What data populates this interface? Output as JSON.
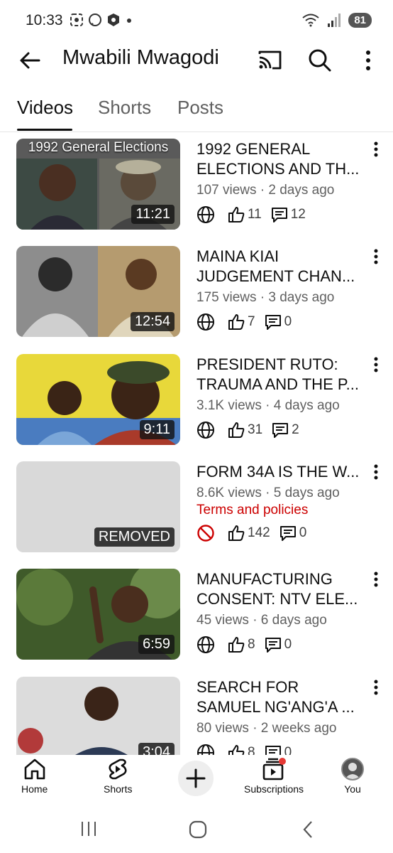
{
  "status_bar": {
    "time": "10:33",
    "battery": "81"
  },
  "header": {
    "title": "Mwabili Mwagodi",
    "icons": [
      "back-arrow-icon",
      "cast-icon",
      "search-icon",
      "more-vert-icon"
    ]
  },
  "tabs": [
    {
      "label": "Videos",
      "active": true
    },
    {
      "label": "Shorts",
      "active": false
    },
    {
      "label": "Posts",
      "active": false
    }
  ],
  "videos": [
    {
      "title_line1": "1992 GENERAL",
      "title_line2": "ELECTIONS AND TH...",
      "meta": "107 views · 2 days ago",
      "duration": "11:21",
      "thumb_text": "1992 General Elections",
      "visibility_icon": "globe-icon",
      "likes": "11",
      "comments": "12"
    },
    {
      "title_line1": "MAINA KIAI",
      "title_line2": "JUDGEMENT CHAN...",
      "meta": "175 views · 3 days ago",
      "duration": "12:54",
      "visibility_icon": "globe-icon",
      "likes": "7",
      "comments": "0"
    },
    {
      "title_line1": "PRESIDENT RUTO:",
      "title_line2": "TRAUMA AND THE P...",
      "meta": "3.1K views · 4 days ago",
      "duration": "9:11",
      "visibility_icon": "globe-icon",
      "likes": "31",
      "comments": "2"
    },
    {
      "title_line1": "FORM 34A IS THE W...",
      "meta": "8.6K views · 5 days ago",
      "policy": "Terms and policies",
      "duration": "REMOVED",
      "visibility_icon": "blocked-icon",
      "likes": "142",
      "comments": "0"
    },
    {
      "title_line1": "MANUFACTURING",
      "title_line2": "CONSENT: NTV ELE...",
      "meta": "45 views · 6 days ago",
      "duration": "6:59",
      "visibility_icon": "globe-icon",
      "likes": "8",
      "comments": "0"
    },
    {
      "title_line1": "SEARCH FOR",
      "title_line2": "SAMUEL NG'ANG'A ...",
      "meta": "80 views · 2 weeks ago",
      "duration": "3:04",
      "visibility_icon": "globe-icon",
      "likes": "8",
      "comments": "0"
    }
  ],
  "bottom_nav": {
    "home": "Home",
    "shorts": "Shorts",
    "subscriptions": "Subscriptions",
    "you": "You"
  },
  "colors": {
    "text_primary": "#0f0f0f",
    "text_secondary": "#606060",
    "policy_red": "#cc0000",
    "notification_dot": "#e53935"
  }
}
